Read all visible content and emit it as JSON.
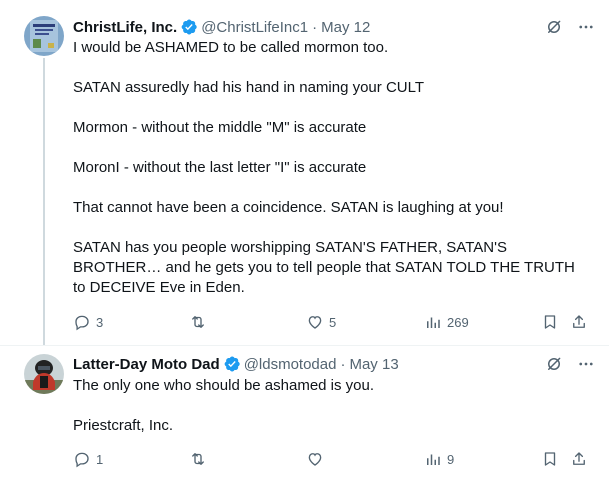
{
  "colors": {
    "text": "#0f1419",
    "secondary": "#536471",
    "verified": "#1d9bf0",
    "thread_line": "#cfd9de"
  },
  "tweets": [
    {
      "display_name": "ChristLife, Inc.",
      "handle": "@ChristLifeInc1",
      "separator": "·",
      "date": "May 12",
      "verified_icon": "verified-badge-icon",
      "paragraphs": [
        "I would be ASHAMED to be called mormon too.",
        "SATAN assuredly had his hand in naming your CULT",
        "Mormon - without the middle \"M\" is accurate",
        "MoronI - without the last letter \"I\" is accurate",
        "That cannot have been a coincidence.  SATAN is laughing at you!",
        "SATAN has you people worshipping SATAN'S FATHER, SATAN'S BROTHER… and he gets you to tell people that SATAN TOLD THE TRUTH to DECEIVE Eve in Eden."
      ],
      "actions": {
        "reply_count": "3",
        "repost_count": "",
        "like_count": "5",
        "views_count": "269"
      }
    },
    {
      "display_name": "Latter-Day Moto Dad",
      "handle": "@ldsmotodad",
      "separator": "·",
      "date": "May 13",
      "verified_icon": "verified-badge-icon",
      "paragraphs": [
        "The only one who should be ashamed is you.",
        "Priestcraft, Inc."
      ],
      "actions": {
        "reply_count": "1",
        "repost_count": "",
        "like_count": "",
        "views_count": "9"
      }
    }
  ]
}
